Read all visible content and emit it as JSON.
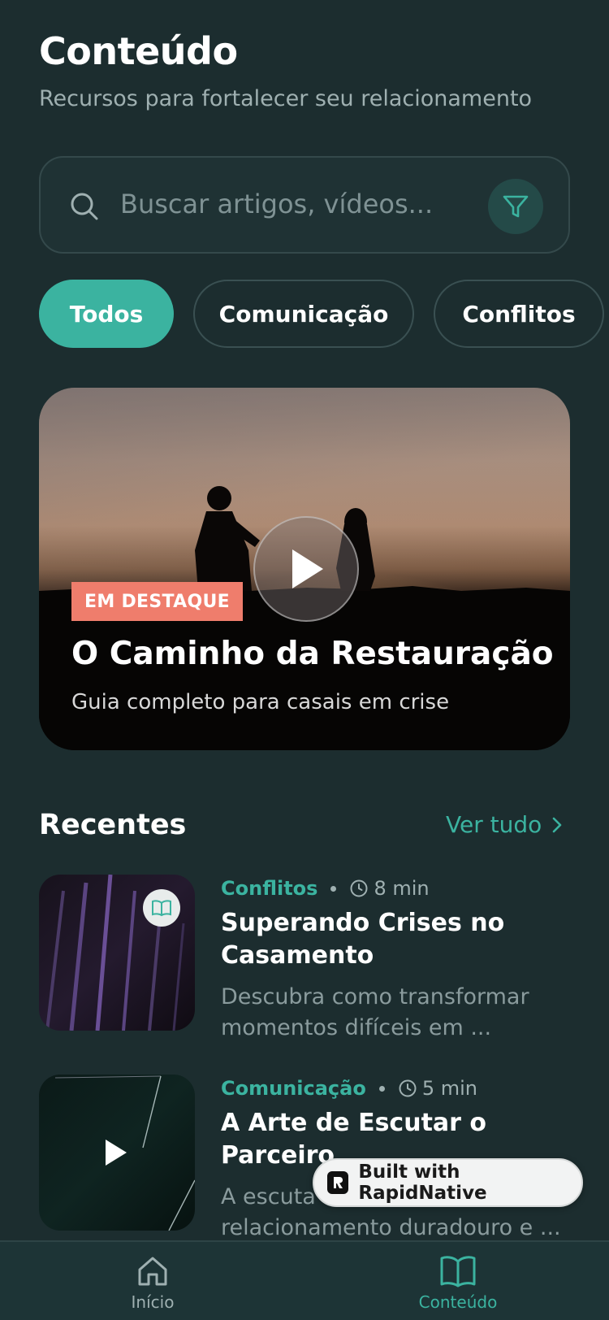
{
  "header": {
    "title": "Conteúdo",
    "subtitle": "Recursos para fortalecer seu relacionamento"
  },
  "search": {
    "placeholder": "Buscar artigos, vídeos..."
  },
  "chips": [
    {
      "label": "Todos",
      "active": true
    },
    {
      "label": "Comunicação",
      "active": false
    },
    {
      "label": "Conflitos",
      "active": false
    }
  ],
  "featured": {
    "badge": "EM DESTAQUE",
    "title": "O Caminho da Restauração",
    "subtitle": "Guia completo para casais em crise"
  },
  "recent": {
    "title": "Recentes",
    "see_all": "Ver tudo",
    "items": [
      {
        "category": "Conflitos",
        "duration": "8 min",
        "title": "Superando Crises no Casamento",
        "description": "Descubra como transformar momentos difíceis em ...",
        "type_icon": "book-icon"
      },
      {
        "category": "Comunicação",
        "duration": "5 min",
        "title": "A Arte de Escutar o Parceiro",
        "description": "A escuta ativa é a base de um relacionamento duradouro e ...",
        "type_icon": "play-icon"
      }
    ]
  },
  "badge": {
    "label": "Built with RapidNative"
  },
  "tabbar": {
    "home": "Início",
    "content": "Conteúdo"
  },
  "colors": {
    "background": "#1c2d2f",
    "accent": "#3bb3a0",
    "featured_badge": "#ef7d6c"
  }
}
